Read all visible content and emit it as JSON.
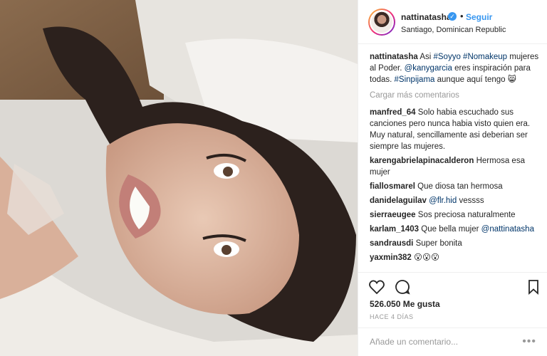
{
  "post": {
    "username": "nattinatasha",
    "follow_label": "Seguir",
    "dot": "•",
    "verified_icon": "✓",
    "location": "Santiago, Dominican Republic"
  },
  "caption": {
    "username": "nattinatasha",
    "text_start": "Asi ",
    "tag1": "#Soyyo",
    "tag2": "#Nomakeup",
    "text_mid": " mujeres al Poder. ",
    "mention": "@kanygarcia",
    "text_mid2": " eres inspiración para todas. ",
    "tag3": "#Sinpijama",
    "text_end": " aunque aquí tengo 😸"
  },
  "load_more": "Cargar más comentarios",
  "comments": [
    {
      "user": "manfred_64",
      "text": "Solo habia escuchado sus canciones pero nunca habia visto quien era. Muy natural, sencillamente asi deberian ser siempre las mujeres."
    },
    {
      "user": "karengabrielapinacalderon",
      "text": "Hermosa esa mujer"
    },
    {
      "user": "fiallosmarel",
      "text": "Que diosa tan hermosa"
    },
    {
      "user": "danidelaguilav",
      "mention": "@flr.hid",
      "text": " vessss"
    },
    {
      "user": "sierraeugee",
      "text": "Sos preciosa naturalmente"
    },
    {
      "user": "karlam_1403",
      "text": "Que bella mujer ",
      "mention": "@nattinatasha"
    },
    {
      "user": "sandrausdi",
      "text": "Super bonita"
    },
    {
      "user": "yaxmin382",
      "text": "😮😮😮"
    }
  ],
  "likes": "526.050 Me gusta",
  "time": "HACE 4 DÍAS",
  "add_comment_placeholder": "Añade un comentario...",
  "more_dots": "•••",
  "colors": {
    "accent": "#3897f0",
    "mention": "#003569"
  }
}
